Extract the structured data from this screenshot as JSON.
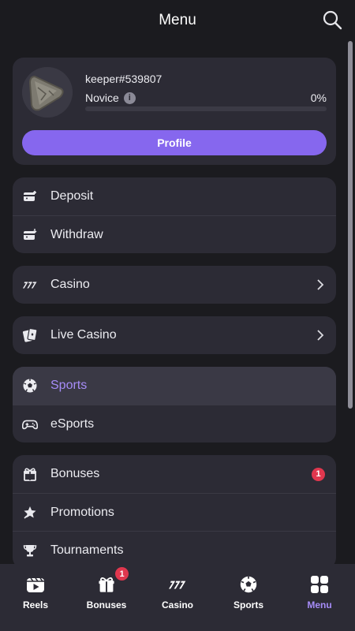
{
  "header": {
    "title": "Menu"
  },
  "profile": {
    "username": "keeper#539807",
    "level": "Novice",
    "progress_text": "0%",
    "progress": 0,
    "button_label": "Profile"
  },
  "groups": [
    {
      "items": [
        {
          "label": "Deposit",
          "icon": "wallet-deposit-icon"
        },
        {
          "label": "Withdraw",
          "icon": "wallet-withdraw-icon"
        }
      ]
    },
    {
      "items": [
        {
          "label": "Casino",
          "icon": "slot-777-icon",
          "chevron": true
        }
      ]
    },
    {
      "items": [
        {
          "label": "Live Casino",
          "icon": "cards-icon",
          "chevron": true
        }
      ]
    },
    {
      "items": [
        {
          "label": "Sports",
          "icon": "soccer-ball-icon",
          "active": true
        },
        {
          "label": "eSports",
          "icon": "gamepad-icon"
        }
      ]
    },
    {
      "items": [
        {
          "label": "Bonuses",
          "icon": "gift-icon",
          "badge": "1"
        },
        {
          "label": "Promotions",
          "icon": "star-icon"
        },
        {
          "label": "Tournaments",
          "icon": "trophy-icon"
        }
      ]
    }
  ],
  "bottom_nav": [
    {
      "label": "Reels",
      "icon": "play-clapper-icon"
    },
    {
      "label": "Bonuses",
      "icon": "gift-icon",
      "badge": "1"
    },
    {
      "label": "Casino",
      "icon": "slot-777-icon"
    },
    {
      "label": "Sports",
      "icon": "soccer-ball-icon"
    },
    {
      "label": "Menu",
      "icon": "grid-icon",
      "active": true
    }
  ],
  "colors": {
    "background": "#1b1b1f",
    "card": "#2c2b35",
    "accent": "#8667ee",
    "active_text": "#a68cf8",
    "badge": "#e0374e"
  }
}
